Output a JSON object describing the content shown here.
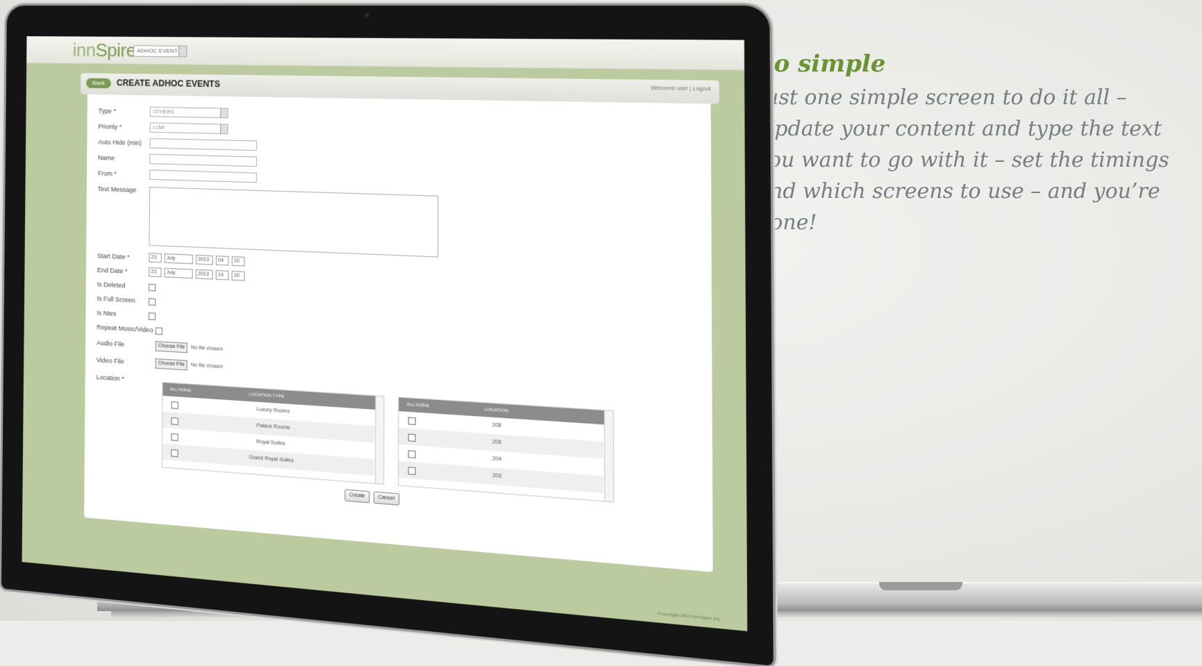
{
  "marketing": {
    "heading": "So simple",
    "body": "Just one simple screen to do it all – Update your content and type the text you want to go with it – set the timings and which screens to use – and you’re done!"
  },
  "app": {
    "logo_prefix": "inn",
    "logo_suffix": "Spire",
    "event_select": "ADHOC EVENT",
    "back_label": "Back",
    "page_title": "CREATE ADHOC EVENTS",
    "top_links": "Welcome user | Logout",
    "copyright": "Copyright 2013 innSpire Inc."
  },
  "form": {
    "type_label": "Type *",
    "type_value": "OTHERS",
    "priority_label": "Priority *",
    "priority_value": "LOW",
    "autohide_label": "Auto Hide (min)",
    "name_label": "Name",
    "from_label": "From *",
    "text_label": "Text Message",
    "start_label": "Start Date *",
    "end_label": "End Date *",
    "start": {
      "day": "23",
      "month": "July",
      "year": "2013",
      "hour": "04",
      "min": "20"
    },
    "end": {
      "day": "23",
      "month": "July",
      "year": "2013",
      "hour": "14",
      "min": "20"
    },
    "deleted_label": "Is Deleted",
    "fullscreen_label": "Is Full Screen",
    "ntes_label": "Is Ntes",
    "repeat_label": "Repeat Music/Video",
    "audio_label": "Audio File",
    "video_label": "Video File",
    "choose_file": "Choose File",
    "no_file": "No file chosen",
    "location_label": "Location *"
  },
  "location_types": {
    "header_all": "ALL  NONE",
    "header_col": "LOCATION TYPE",
    "rows": [
      "Luxury Rooms",
      "Palace Rooms",
      "Royal Suites",
      "Grand Royal Suites"
    ]
  },
  "locations": {
    "header_all": "ALL  NONE",
    "header_col": "LOCATION",
    "rows": [
      "208",
      "205",
      "204",
      "203"
    ]
  },
  "buttons": {
    "create": "Create",
    "cancel": "Cancel"
  }
}
